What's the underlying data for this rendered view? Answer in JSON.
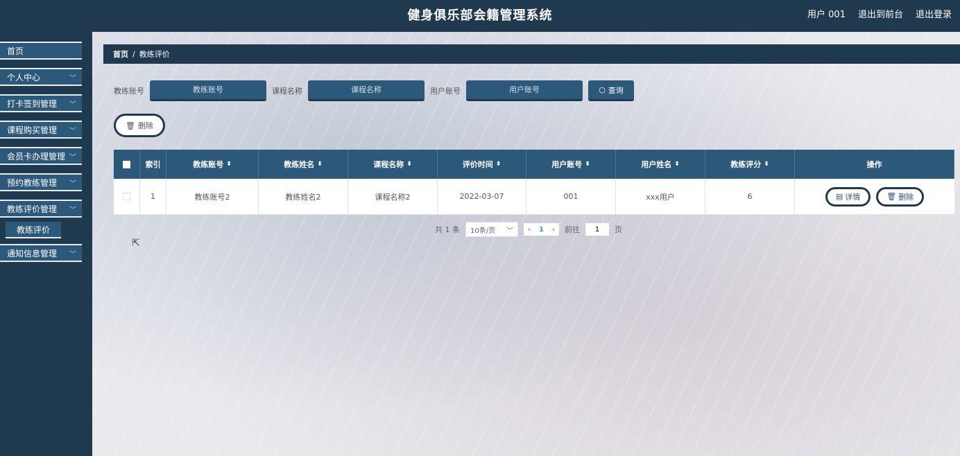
{
  "header": {
    "title": "健身俱乐部会籍管理系统",
    "user": "用户 001",
    "to_front": "退出到前台",
    "logout": "退出登录"
  },
  "sidebar": {
    "items": [
      {
        "label": "首页"
      },
      {
        "label": "个人中心"
      },
      {
        "label": "打卡签到管理"
      },
      {
        "label": "课程购买管理"
      },
      {
        "label": "会员卡办理管理"
      },
      {
        "label": "预约教练管理"
      },
      {
        "label": "教练评价管理"
      },
      {
        "label": "通知信息管理"
      }
    ],
    "sub_item": "教练评价"
  },
  "breadcrumb": {
    "home": "首页",
    "separator": "/",
    "current": "教练评价"
  },
  "search": {
    "coach_account_label": "教练账号",
    "coach_account_placeholder": "教练账号",
    "course_name_label": "课程名称",
    "course_name_placeholder": "课程名称",
    "user_account_label": "用户账号",
    "user_account_placeholder": "用户账号",
    "query_label": "查询"
  },
  "actions": {
    "delete_label": "删除"
  },
  "table": {
    "headers": [
      "索引",
      "教练账号",
      "教练姓名",
      "课程名称",
      "评价时间",
      "用户账号",
      "用户姓名",
      "教练评分",
      "操作"
    ],
    "rows": [
      {
        "index": "1",
        "coach_account": "教练账号2",
        "coach_name": "教练姓名2",
        "course_name": "课程名称2",
        "review_time": "2022-03-07",
        "user_account": "001",
        "user_name": "xxx用户",
        "score": "6",
        "detail_label": "详情",
        "delete_label": "删除"
      }
    ]
  },
  "pager": {
    "total": "共 1 条",
    "page_size": "10条/页",
    "current_page": "1",
    "goto_label": "前往",
    "goto_value": "1",
    "page_unit": "页"
  }
}
